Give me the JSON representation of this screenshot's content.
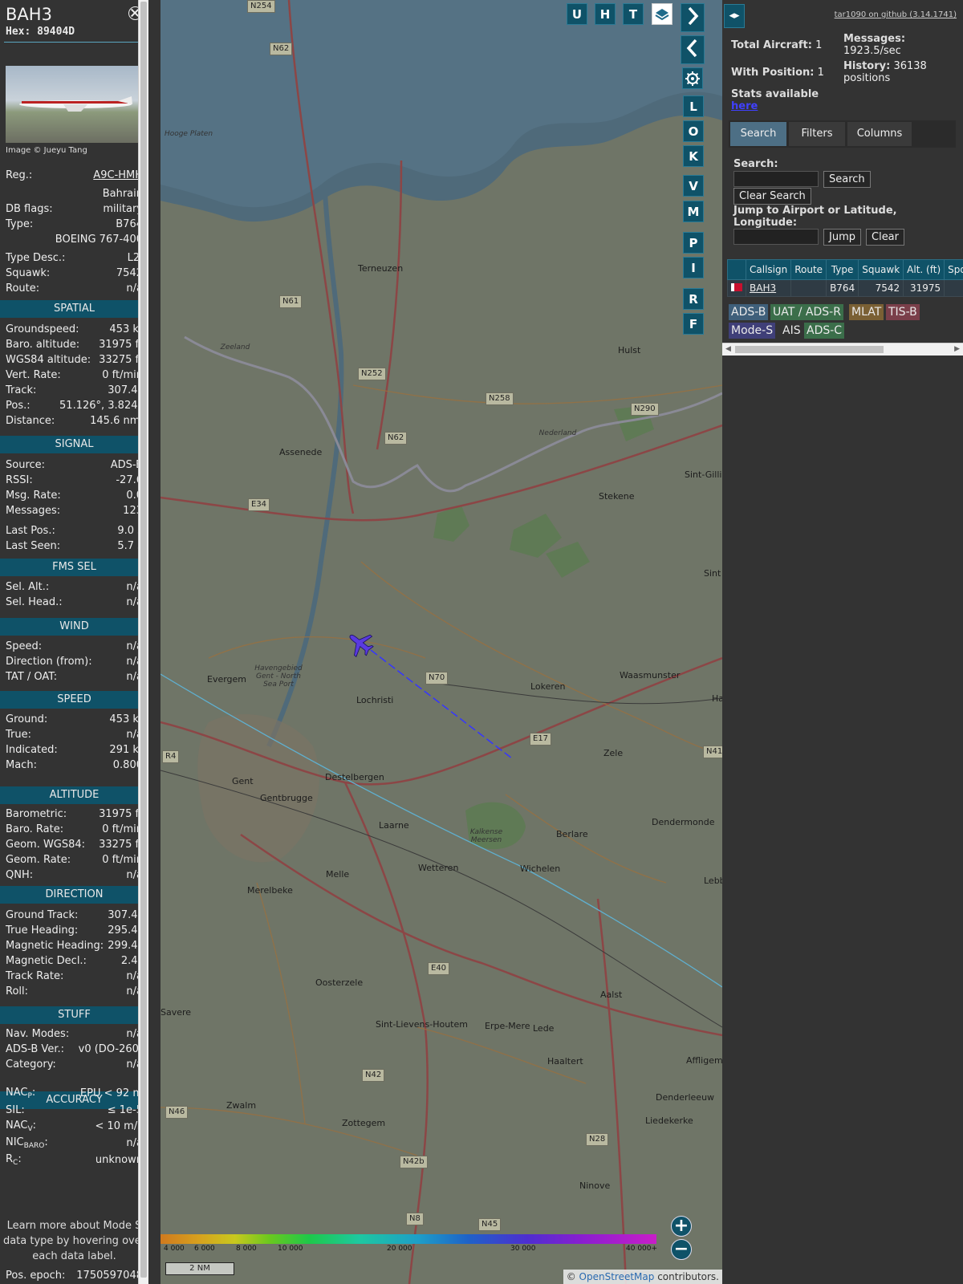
{
  "aircraft": {
    "callsign": "BAH3",
    "hex_label": "Hex:",
    "hex": "89404D",
    "image_credit": "Image © Jueyu Tang"
  },
  "info": {
    "reg_label": "Reg.:",
    "reg": "A9C-HMH",
    "country": "Bahrain",
    "dbflags_label": "DB flags:",
    "dbflags": "military",
    "type_label": "Type:",
    "type": "B764",
    "type_full": "BOEING 767-400",
    "typedesc_label": "Type Desc.:",
    "typedesc": "L2J",
    "squawk_label": "Squawk:",
    "squawk": "7542",
    "route_label": "Route:",
    "route": "n/a"
  },
  "spatial": {
    "title": "SPATIAL",
    "rows": [
      {
        "label": "Groundspeed:",
        "value": "453 kt"
      },
      {
        "label": "Baro. altitude:",
        "value": "31975 ft"
      },
      {
        "label": "WGS84 altitude:",
        "value": "33275 ft"
      },
      {
        "label": "Vert. Rate:",
        "value": "0 ft/min"
      },
      {
        "label": "Track:",
        "value": "307.4°"
      },
      {
        "label": "Pos.:",
        "value": "51.126°, 3.824°"
      },
      {
        "label": "Distance:",
        "value": "145.6 nmi"
      }
    ]
  },
  "signal": {
    "title": "SIGNAL",
    "rows": [
      {
        "label": "Source:",
        "value": "ADS-B"
      },
      {
        "label": "RSSI:",
        "value": "-27.6"
      },
      {
        "label": "Msg. Rate:",
        "value": "0.0"
      },
      {
        "label": "Messages:",
        "value": "123"
      },
      {
        "label": "Last Pos.:",
        "value": "9.0 s"
      },
      {
        "label": "Last Seen:",
        "value": "5.7 s"
      }
    ]
  },
  "fms": {
    "title": "FMS SEL",
    "rows": [
      {
        "label": "Sel. Alt.:",
        "value": "n/a"
      },
      {
        "label": "Sel. Head.:",
        "value": "n/a"
      }
    ]
  },
  "wind": {
    "title": "WIND",
    "rows": [
      {
        "label": "Speed:",
        "value": "n/a"
      },
      {
        "label": "Direction (from):",
        "value": "n/a"
      },
      {
        "label": "TAT / OAT:",
        "value": "n/a"
      }
    ]
  },
  "speed": {
    "title": "SPEED",
    "rows": [
      {
        "label": "Ground:",
        "value": "453 kt"
      },
      {
        "label": "True:",
        "value": "n/a"
      },
      {
        "label": "Indicated:",
        "value": "291 kt"
      },
      {
        "label": "Mach:",
        "value": "0.800"
      }
    ]
  },
  "altitude": {
    "title": "ALTITUDE",
    "rows": [
      {
        "label": "Barometric:",
        "value": "31975 ft"
      },
      {
        "label": "Baro. Rate:",
        "value": "0 ft/min"
      },
      {
        "label": "Geom. WGS84:",
        "value": "33275 ft"
      },
      {
        "label": "Geom. Rate:",
        "value": "0 ft/min"
      },
      {
        "label": "QNH:",
        "value": "n/a"
      }
    ]
  },
  "direction": {
    "title": "DIRECTION",
    "rows": [
      {
        "label": "Ground Track:",
        "value": "307.4°"
      },
      {
        "label": "True Heading:",
        "value": "295.4°"
      },
      {
        "label": "Magnetic Heading:",
        "value": "299.4°"
      },
      {
        "label": "Magnetic Decl.:",
        "value": "2.4°"
      },
      {
        "label": "Track Rate:",
        "value": "n/a"
      },
      {
        "label": "Roll:",
        "value": "n/a"
      }
    ]
  },
  "stuff": {
    "title": "STUFF",
    "rows": [
      {
        "label": "Nav. Modes:",
        "value": "n/a"
      },
      {
        "label": "ADS-B Ver.:",
        "value": "v0 (DO-260)"
      },
      {
        "label": "Category:",
        "value": "n/a"
      }
    ]
  },
  "accuracy": {
    "title": "ACCURACY",
    "nacp_label": "NAC",
    "nacp_sub": "P",
    "nacp": "EPU < 92 m",
    "sil_label": "SIL:",
    "sil": "≤ 1e-5",
    "nacv_label": "NAC",
    "nacv_sub": "V",
    "nacv": "< 10 m/s",
    "nicbaro_label": "NIC",
    "nicbaro_sub": "BARO",
    "nicbaro": "n/a",
    "rc_label": "R",
    "rc_sub": "C",
    "rc": "unknown"
  },
  "learn_text": "Learn more about Mode S data type by hovering over each data label.",
  "pos_epoch_label": "Pos. epoch:",
  "pos_epoch": "1750597048",
  "map": {
    "buttons_top": [
      "U",
      "H",
      "T"
    ],
    "buttons_side": [
      "L",
      "O",
      "K",
      "V",
      "M",
      "P",
      "I",
      "R",
      "F"
    ],
    "scale": "2 NM",
    "attribution_prefix": "© ",
    "attribution_link": "OpenStreetMap",
    "attribution_suffix": " contributors.",
    "alt_ticks": [
      "4 000",
      "6 000",
      "8 000",
      "10 000",
      "20 000",
      "30 000",
      "40 000+"
    ],
    "places": [
      "Terneuzen",
      "Hulst",
      "Assenede",
      "Stekene",
      "Sint-Gillis",
      "Evergem",
      "Lochristi",
      "Lokeren",
      "Waasmunster",
      "Gent",
      "Destelbergen",
      "Gentbrugge",
      "Zele",
      "Laarne",
      "Berlare",
      "Dendermonde",
      "Wetteren",
      "Wichelen",
      "Melle",
      "Merelbeke",
      "Lede",
      "Oosterzele",
      "Aalst",
      "Sint-Lievens-Houtem",
      "Erpe-Mere",
      "Haaltert",
      "Affligem",
      "Denderleeuw",
      "Liedekerke",
      "Zwalm",
      "Zottegem",
      "Ninove",
      "Savere",
      "Lebb",
      "Sint",
      "Ha",
      "Havengebied Gent - North Sea Port",
      "Kalkense Meersen",
      "Hooge Platen",
      "Zeeland",
      "Nederland"
    ],
    "roads": [
      "N62",
      "N61",
      "N252",
      "N258",
      "N290",
      "N62",
      "E34",
      "N70",
      "E17",
      "R4",
      "N41",
      "E40",
      "N42",
      "N46",
      "N28",
      "N42b",
      "N8",
      "N45",
      "N254"
    ]
  },
  "side": {
    "github": "tar1090 on github (3.14.1741)",
    "total_label": "Total Aircraft:",
    "total": "1",
    "withpos_label": "With Position:",
    "withpos": "1",
    "messages_label": "Messages:",
    "messages": "1923.5/sec",
    "history_label": "History:",
    "history": "36138 positions",
    "stats_text": "Stats available",
    "stats_link": "here",
    "tabs": [
      "Search",
      "Filters",
      "Columns"
    ],
    "search_label": "Search:",
    "search_button": "Search",
    "clear_search_button": "Clear Search",
    "jump_label": "Jump to Airport or Latitude, Longitude:",
    "jump_button": "Jump",
    "clear_button": "Clear",
    "columns": [
      "Callsign",
      "Route",
      "Type",
      "Squawk",
      "Alt. (ft)",
      "Spd."
    ],
    "table_rows": [
      {
        "callsign": "BAH3",
        "route": "",
        "type": "B764",
        "squawk": "7542",
        "alt": "31975",
        "spd": ""
      }
    ],
    "sources": [
      {
        "label": "ADS-B",
        "color": "#3f5f7a"
      },
      {
        "label": "UAT / ADS-R",
        "color": "#3b6e4a"
      },
      {
        "label": "MLAT",
        "color": "#7a6034"
      },
      {
        "label": "TIS-B",
        "color": "#7a3f4a"
      },
      {
        "label": "Mode-S",
        "color": "#3f3f78"
      },
      {
        "label": "AIS",
        "color": ""
      },
      {
        "label": "ADS-C",
        "color": "#3b6e4a"
      }
    ]
  }
}
